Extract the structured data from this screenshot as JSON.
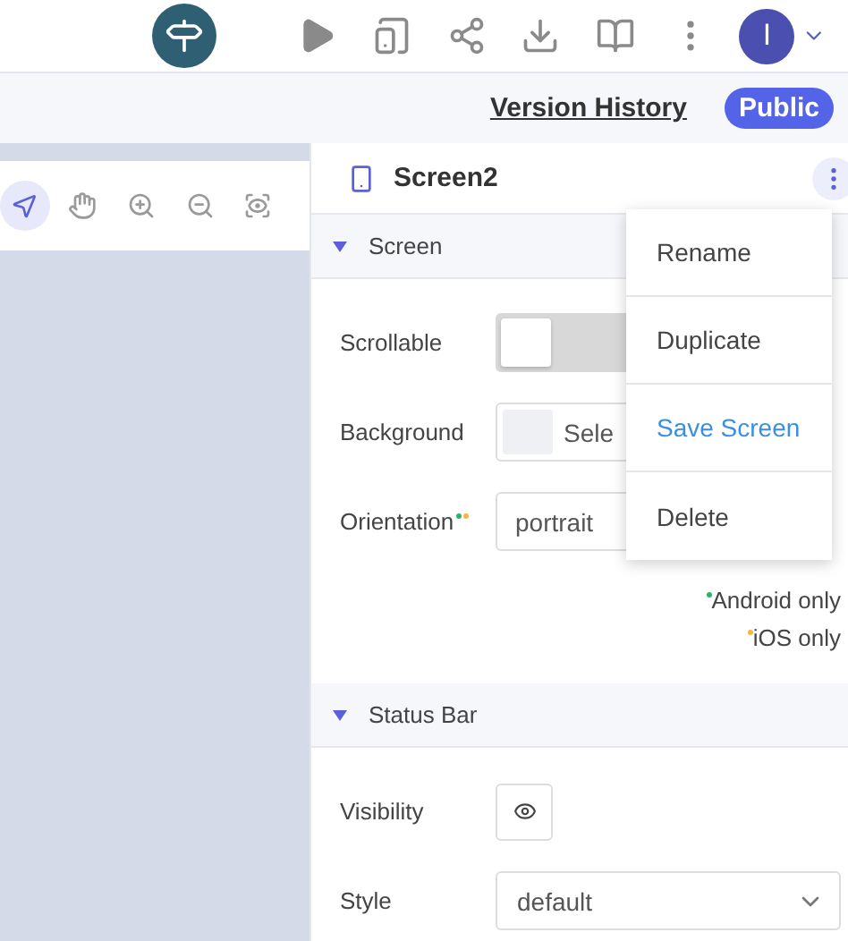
{
  "top_bar": {
    "avatar": {
      "initial": "I"
    }
  },
  "sub_bar": {
    "version_history": "Version History",
    "visibility_badge": "Public"
  },
  "canvas_toolbar": [
    {
      "selected": true
    },
    {
      "selected": false
    },
    {
      "selected": false
    },
    {
      "selected": false
    },
    {
      "selected": false
    }
  ],
  "panel": {
    "title": "Screen2",
    "sections": [
      {
        "title": "Screen",
        "expanded": true,
        "rows": [
          {
            "kind": "toggle",
            "label": "Scrollable",
            "on": false
          },
          {
            "kind": "color",
            "label": "Background",
            "value": "Sele"
          },
          {
            "kind": "select",
            "label": "Orientation",
            "value": "portrait",
            "markers": [
              {
                "color": "#2fb36b"
              },
              {
                "color": "#f5b73b"
              }
            ]
          }
        ],
        "notes": [
          {
            "text": "Android only",
            "color": "#2fb36b"
          },
          {
            "text": "iOS only",
            "color": "#f5b73b"
          }
        ]
      },
      {
        "title": "Status Bar",
        "expanded": true,
        "rows": [
          {
            "kind": "eye",
            "label": "Visibility",
            "on": true
          },
          {
            "kind": "dropdown",
            "label": "Style",
            "value": "default"
          }
        ]
      }
    ]
  },
  "menu": [
    {
      "label": "Rename",
      "selected": false
    },
    {
      "label": "Duplicate",
      "selected": false
    },
    {
      "label": "Save Screen",
      "selected": true
    },
    {
      "label": "Delete",
      "selected": false
    }
  ]
}
